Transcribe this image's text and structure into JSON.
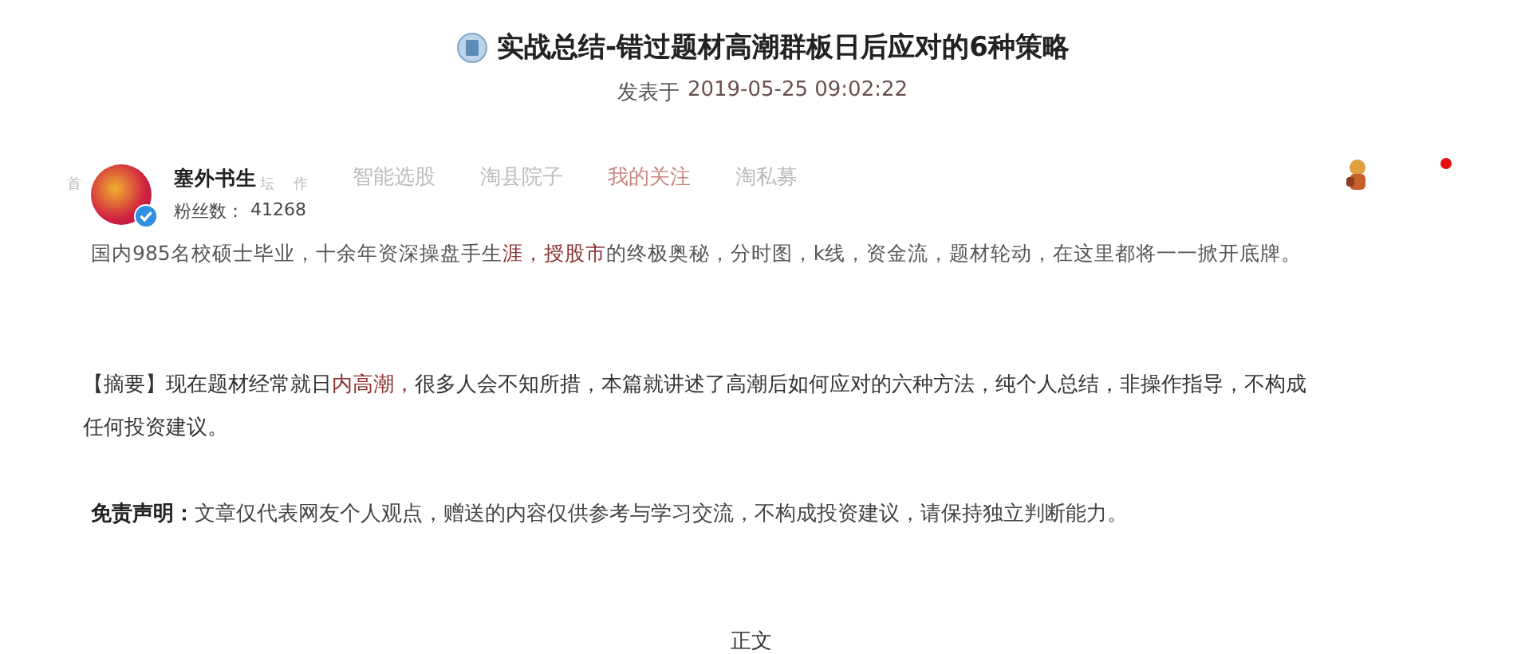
{
  "article": {
    "title": "实战总结-错过题材高潮群板日后应对的6种策略",
    "posted_label": "发表于",
    "posted_at": "2019-05-25 09:02:22"
  },
  "nav": [
    {
      "label": "首",
      "selected": false
    },
    {
      "label": "坛",
      "selected": false
    },
    {
      "label": "作",
      "selected": false
    },
    {
      "label": "智能选股",
      "selected": false
    },
    {
      "label": "淘县院子",
      "selected": false
    },
    {
      "label": "我的关注",
      "selected": true
    },
    {
      "label": "淘私募",
      "selected": false
    }
  ],
  "author": {
    "name": "塞外书生",
    "verified": true,
    "fans_label": "粉丝数：",
    "fans": "41268"
  },
  "bio": [
    {
      "text": "国内985名校硕士毕业，十余年资深操盘手生",
      "highlight": false
    },
    {
      "text": "涯，授股市",
      "highlight": true
    },
    {
      "text": "的终极奥秘，分时图，k线，资金流，题材轮动，在这里都将一一掀开底牌。",
      "highlight": false
    }
  ],
  "summary": [
    {
      "text": "【摘要】现在题材经常就日",
      "highlight": false
    },
    {
      "text": "内高潮，",
      "highlight": true
    },
    {
      "text": "很多人会不知所措，本篇就讲述了高潮后如何应对的六种方法，纯个人总结，非操作指导，不构成任何投资建议。",
      "highlight": false
    }
  ],
  "disclaimer": {
    "label": "免责声明：",
    "text": "文章仅代表网友个人观点，赠送的内容仅供参考与学习交流，不构成投资建议，请保持独立判断能力。"
  },
  "section_heading": "正文"
}
